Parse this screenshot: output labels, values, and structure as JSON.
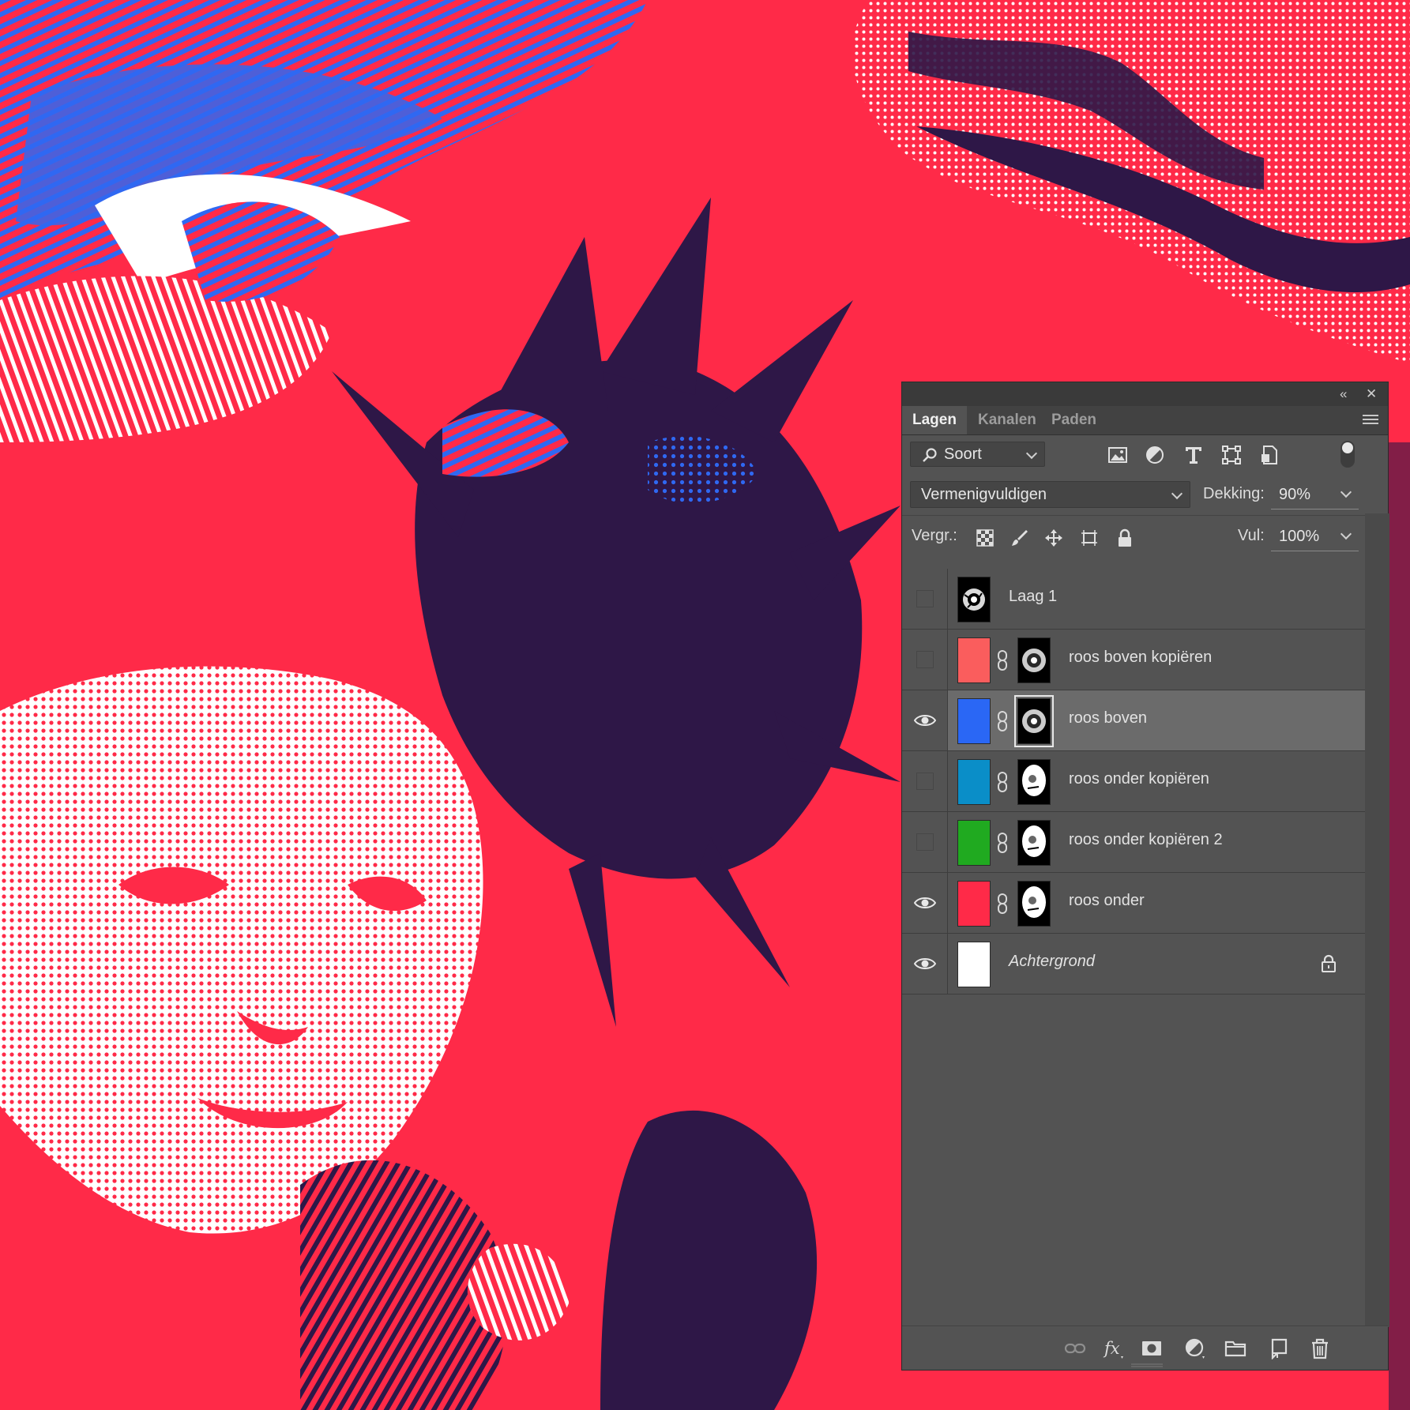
{
  "panel": {
    "collapse_icon": "double-chevron-left-icon",
    "close_icon": "close-icon",
    "tabs": [
      {
        "label": "Lagen",
        "active": true
      },
      {
        "label": "Kanalen",
        "active": false
      },
      {
        "label": "Paden",
        "active": false
      }
    ],
    "filter": {
      "kind_label": "Soort",
      "filter_icons": [
        "pixel-layer-filter-icon",
        "adjustment-layer-filter-icon",
        "type-layer-filter-icon",
        "shape-layer-filter-icon",
        "smart-object-filter-icon"
      ],
      "filter_toggle_on": true
    },
    "blend": {
      "mode": "Vermenigvuldigen",
      "opacity_label": "Dekking:",
      "opacity_value": "90%"
    },
    "lock": {
      "label": "Vergr.:",
      "icons": [
        "lock-transparent-pixels-icon",
        "lock-image-pixels-icon",
        "lock-position-icon",
        "lock-artboard-icon",
        "lock-all-icon"
      ],
      "fill_label": "Vul:",
      "fill_value": "100%"
    },
    "layers": [
      {
        "name": "Laag 1",
        "visible": false,
        "selected": false,
        "thumb_color": "#000000",
        "has_mask": false,
        "locked": false,
        "italic": false
      },
      {
        "name": "roos boven kopiëren",
        "visible": false,
        "selected": false,
        "thumb_color": "#fa5d5d",
        "has_mask": true,
        "locked": false,
        "italic": false
      },
      {
        "name": "roos boven",
        "visible": true,
        "selected": true,
        "thumb_color": "#2a67f5",
        "has_mask": true,
        "locked": false,
        "italic": false
      },
      {
        "name": "roos onder kopiëren",
        "visible": false,
        "selected": false,
        "thumb_color": "#0a8ec8",
        "has_mask": true,
        "locked": false,
        "italic": false
      },
      {
        "name": "roos onder kopiëren 2",
        "visible": false,
        "selected": false,
        "thumb_color": "#20aa20",
        "has_mask": true,
        "locked": false,
        "italic": false
      },
      {
        "name": "roos onder",
        "visible": true,
        "selected": false,
        "thumb_color": "#ff2a48",
        "has_mask": true,
        "locked": false,
        "italic": false
      },
      {
        "name": "Achtergrond",
        "visible": true,
        "selected": false,
        "thumb_color": "#ffffff",
        "has_mask": false,
        "locked": true,
        "italic": true
      }
    ],
    "footer_icons": [
      "link-layers-icon",
      "fx-icon",
      "add-mask-icon",
      "adjustment-layer-icon",
      "new-group-icon",
      "new-layer-icon",
      "trash-icon"
    ]
  },
  "colors": {
    "art_red": "#ff2a48",
    "art_blue": "#2f68f2",
    "art_indigo": "#2e1747",
    "art_white": "#ffffff",
    "panel_bg": "#535353",
    "selected_row": "#6b6b6b"
  }
}
